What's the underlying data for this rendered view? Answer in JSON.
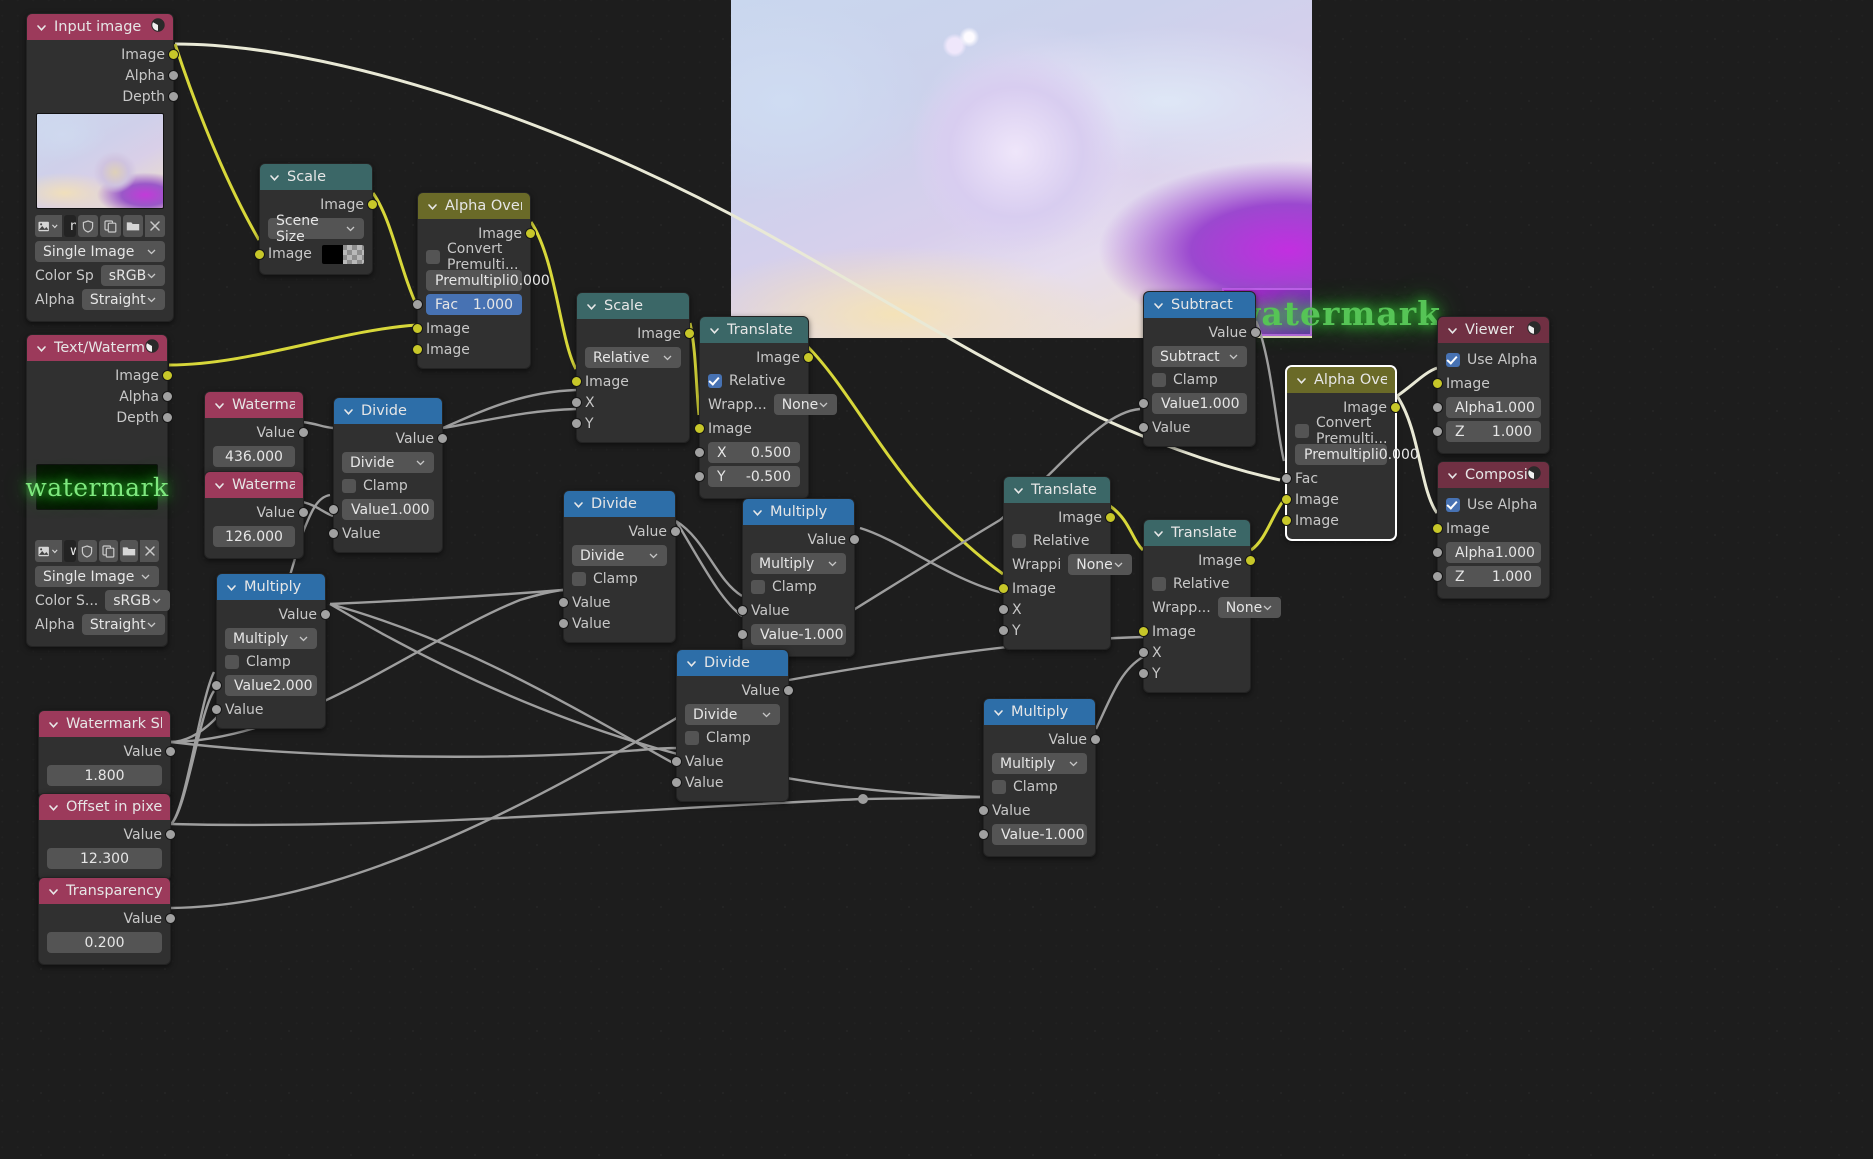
{
  "app": {
    "editor": "Blender Compositor Node Editor"
  },
  "backdrop": {
    "watermark_text": "watermark",
    "preview_name": "render-preview"
  },
  "icons": {
    "caret": "chevron-down-icon",
    "node_image": "image-node-icon",
    "chevron": "chevron-down-icon",
    "shield": "shield-icon",
    "duplicate": "duplicate-icon",
    "folder": "folder-icon",
    "close": "close-icon"
  },
  "colors": {
    "input_header": "#9c3a5b",
    "output_header": "#703043",
    "color_header": "#6a6a28",
    "distort_header": "#3b6767",
    "converter_header": "#2d6ea8",
    "image_socket": "#c7c729",
    "value_socket": "#a1a1a1",
    "accent_blue": "#4772b3",
    "wire": "#9e9e9e",
    "wire_image": "#d7d73a"
  },
  "nodes": {
    "input_image": {
      "title": "Input image",
      "outputs": [
        "Image",
        "Alpha",
        "Depth"
      ],
      "file_name": "mila...",
      "source": "Single Image",
      "color_space_label": "Color Sp",
      "color_space": "sRGB",
      "alpha_label": "Alpha",
      "alpha": "Straight"
    },
    "text_watermark": {
      "title": "Text/Watermark",
      "outputs": [
        "Image",
        "Alpha",
        "Depth"
      ],
      "preview_text": "watermark",
      "file_name": "wat...",
      "source": "Single Image",
      "color_space_label": "Color S...",
      "color_space": "sRGB",
      "alpha_label": "Alpha",
      "alpha": "Straight"
    },
    "watermark_shrink": {
      "title": "Watermark Shrinking facto",
      "output": "Value",
      "value": "1.800"
    },
    "offset_pixels": {
      "title": "Offset in pixels",
      "output": "Value",
      "value": "12.300"
    },
    "transparency": {
      "title": "Transparency",
      "output": "Value",
      "value": "0.200"
    },
    "watermark_x": {
      "title": "Watermark X",
      "output": "Value",
      "value": "436.000"
    },
    "watermark_y": {
      "title": "Watermark Y",
      "output": "Value",
      "value": "126.000"
    },
    "scale_scene": {
      "title": "Scale",
      "output": "Image",
      "mode": "Scene Size",
      "input_label": "Image"
    },
    "alpha_over_1": {
      "title": "Alpha Over",
      "output": "Image",
      "convert_label": "Convert Premulti...",
      "convert_checked": false,
      "premul_label": "Premultipli",
      "premul_value": "0.000",
      "fac_label": "Fac",
      "fac_value": "1.000",
      "inputs": [
        "Image",
        "Image"
      ]
    },
    "scale_relative": {
      "title": "Scale",
      "output": "Image",
      "mode": "Relative",
      "inputs": [
        "Image",
        "X",
        "Y"
      ]
    },
    "translate_1": {
      "title": "Translate",
      "output": "Image",
      "relative_label": "Relative",
      "relative_checked": true,
      "wrapping_label": "Wrapp...",
      "wrapping": "None",
      "image_label": "Image",
      "x_label": "X",
      "x_value": "0.500",
      "y_label": "Y",
      "y_value": "-0.500"
    },
    "divide_1": {
      "title": "Divide",
      "output": "Value",
      "operation": "Divide",
      "clamp_label": "Clamp",
      "clamp_checked": false,
      "value_label": "Value",
      "value_1": "1.000",
      "input_2_label": "Value"
    },
    "multiply_1": {
      "title": "Multiply",
      "output": "Value",
      "operation": "Multiply",
      "clamp_label": "Clamp",
      "clamp_checked": false,
      "value_label": "Value",
      "value_1": "2.000",
      "input_2_label": "Value"
    },
    "divide_2": {
      "title": "Divide",
      "output": "Value",
      "operation": "Divide",
      "clamp_label": "Clamp",
      "clamp_checked": false,
      "input_1_label": "Value",
      "input_2_label": "Value"
    },
    "multiply_2": {
      "title": "Multiply",
      "output": "Value",
      "operation": "Multiply",
      "clamp_label": "Clamp",
      "clamp_checked": false,
      "input_1_label": "Value",
      "value_label": "Value",
      "value_2": "-1.000"
    },
    "divide_3": {
      "title": "Divide",
      "output": "Value",
      "operation": "Divide",
      "clamp_label": "Clamp",
      "clamp_checked": false,
      "input_1_label": "Value",
      "input_2_label": "Value"
    },
    "multiply_3": {
      "title": "Multiply",
      "output": "Value",
      "operation": "Multiply",
      "clamp_label": "Clamp",
      "clamp_checked": false,
      "input_1_label": "Value",
      "value_label": "Value",
      "value_2": "-1.000"
    },
    "translate_2": {
      "title": "Translate",
      "output": "Image",
      "relative_label": "Relative",
      "relative_checked": false,
      "wrapping_label": "Wrappi",
      "wrapping": "None",
      "image_label": "Image",
      "x_label": "X",
      "y_label": "Y"
    },
    "translate_3": {
      "title": "Translate",
      "output": "Image",
      "relative_label": "Relative",
      "relative_checked": false,
      "wrapping_label": "Wrapp...",
      "wrapping": "None",
      "image_label": "Image",
      "x_label": "X",
      "y_label": "Y"
    },
    "subtract": {
      "title": "Subtract",
      "output": "Value",
      "operation": "Subtract",
      "clamp_label": "Clamp",
      "clamp_checked": false,
      "value_label": "Value",
      "value_1": "1.000",
      "input_2_label": "Value"
    },
    "alpha_over_2": {
      "title": "Alpha Over",
      "output": "Image",
      "convert_label": "Convert Premulti...",
      "convert_checked": false,
      "premul_label": "Premultipli",
      "premul_value": "0.000",
      "fac_label": "Fac",
      "inputs": [
        "Image",
        "Image"
      ]
    },
    "viewer": {
      "title": "Viewer",
      "use_alpha_label": "Use Alpha",
      "use_alpha_checked": true,
      "image_label": "Image",
      "alpha_label": "Alpha",
      "alpha_value": "1.000",
      "z_label": "Z",
      "z_value": "1.000"
    },
    "composite": {
      "title": "Composite",
      "use_alpha_label": "Use Alpha",
      "use_alpha_checked": true,
      "image_label": "Image",
      "alpha_label": "Alpha",
      "alpha_value": "1.000",
      "z_label": "Z",
      "z_value": "1.000"
    }
  }
}
